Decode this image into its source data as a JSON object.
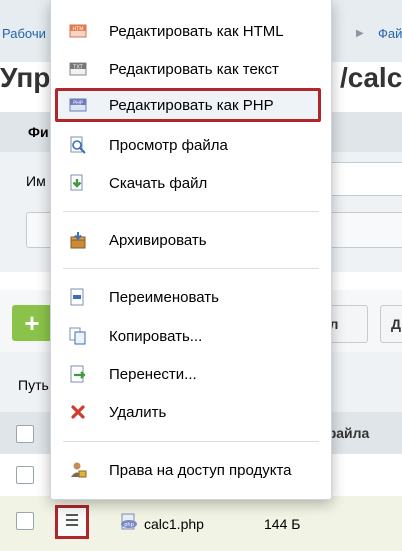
{
  "breadcrumb": {
    "first": "Рабочи",
    "last": "Фай"
  },
  "page_title": {
    "left": "Упр",
    "right": "/calc"
  },
  "form": {
    "tab_label": "Фи",
    "field_label": "Им"
  },
  "toolbar": {
    "add_label": "+",
    "button_right_label": "л",
    "button_far_right_label": "Д"
  },
  "path_label": "Путь",
  "grid": {
    "name_header": "файла"
  },
  "file_row": {
    "name": "calc1.php",
    "size": "144 Б",
    "icon": "php-file-icon"
  },
  "context_menu": {
    "items": [
      {
        "label": "Редактировать как HTML",
        "icon": "html-edit-icon",
        "highlighted": false
      },
      {
        "label": "Редактировать как текст",
        "icon": "text-edit-icon",
        "highlighted": false
      },
      {
        "label": "Редактировать как PHP",
        "icon": "php-edit-icon",
        "highlighted": true
      },
      {
        "label": "Просмотр файла",
        "icon": "view-file-icon",
        "highlighted": false
      },
      {
        "label": "Скачать файл",
        "icon": "download-icon",
        "highlighted": false
      },
      {
        "label": "Архивировать",
        "icon": "archive-icon",
        "highlighted": false
      },
      {
        "label": "Переименовать",
        "icon": "rename-icon",
        "highlighted": false
      },
      {
        "label": "Копировать...",
        "icon": "copy-icon",
        "highlighted": false
      },
      {
        "label": "Перенести...",
        "icon": "move-icon",
        "highlighted": false
      },
      {
        "label": "Удалить",
        "icon": "delete-icon",
        "highlighted": false
      },
      {
        "label": "Права на доступ продукта",
        "icon": "access-rights-icon",
        "highlighted": false
      }
    ]
  },
  "colors": {
    "highlight_border": "#b0262a",
    "add_button": "#8bc34a",
    "link": "#2067b0"
  }
}
